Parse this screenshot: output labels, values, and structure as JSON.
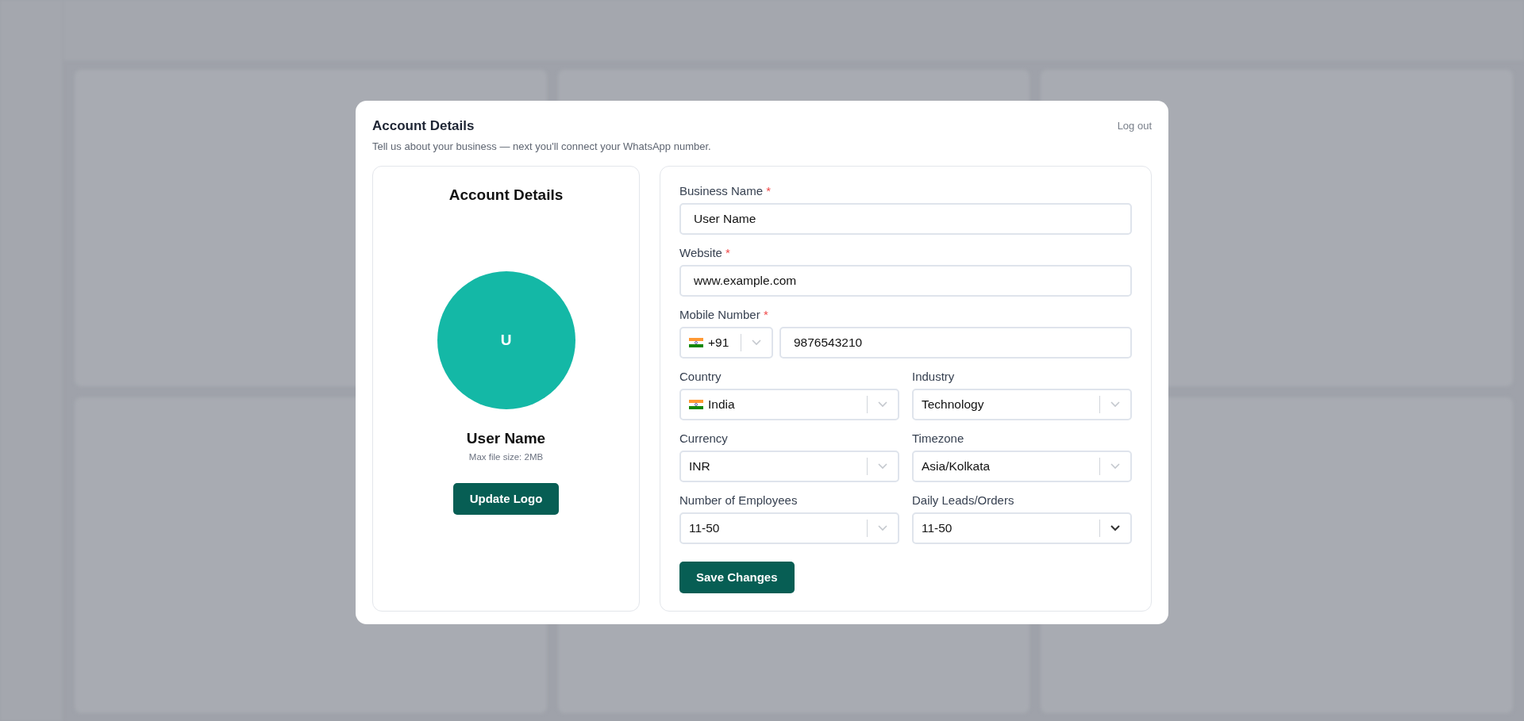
{
  "modal": {
    "title": "Account Details",
    "subtitle": "Tell us about your business — next you'll connect your WhatsApp number.",
    "logout": "Log out"
  },
  "logo_card": {
    "title": "Account Details",
    "avatar_initial": "U",
    "name": "User Name",
    "hint": "Max file size: 2MB",
    "button": "Update Logo"
  },
  "fields": [
    {
      "kind": "text",
      "label": "Business Name",
      "required_mark": "*",
      "value": "User Name"
    },
    {
      "kind": "text",
      "label": "Website",
      "required_mark": "*",
      "value": "www.example.com"
    },
    {
      "kind": "phone",
      "label": "Mobile Number",
      "required_mark": "*",
      "code": "+91",
      "value": "9876543210"
    }
  ],
  "selects": [
    {
      "label": "Country",
      "value": "India",
      "flag": true,
      "active": false
    },
    {
      "label": "Industry",
      "value": "Technology",
      "flag": false,
      "active": false
    },
    {
      "label": "Currency",
      "value": "INR",
      "flag": false,
      "active": false
    },
    {
      "label": "Timezone",
      "value": "Asia/Kolkata",
      "flag": false,
      "active": false
    },
    {
      "label": "Number of Employees",
      "value": "11-50",
      "flag": false,
      "active": false
    },
    {
      "label": "Daily Leads/Orders",
      "value": "11-50",
      "flag": false,
      "active": true
    }
  ],
  "save_button": "Save Changes"
}
